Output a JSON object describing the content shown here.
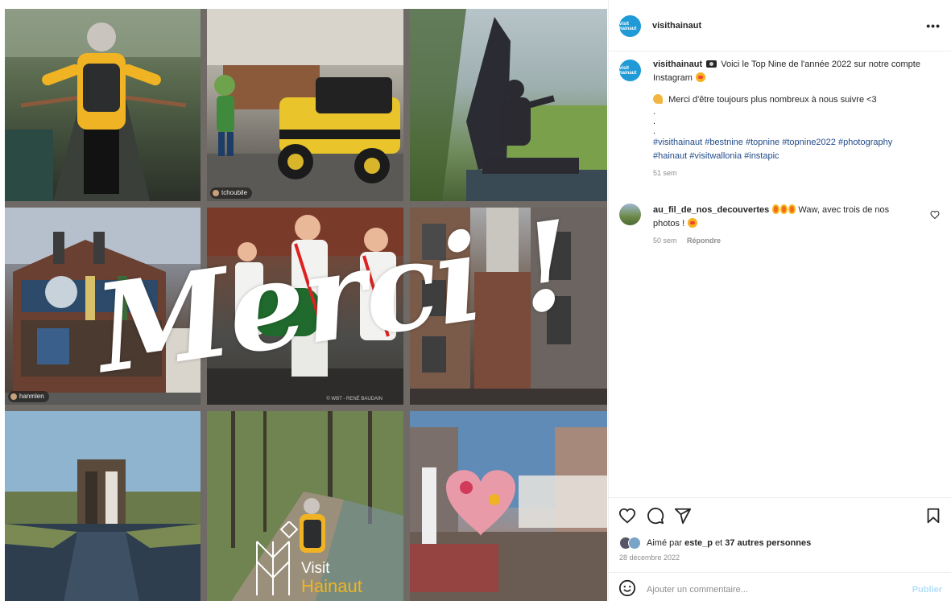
{
  "post": {
    "username": "visithainaut",
    "avatar_text": "visit hainaut",
    "more_label": "•••",
    "caption": {
      "text_1": "Voici le Top Nine de l'année 2022 sur notre compte Instagram",
      "text_2": "Merci d'être toujours plus nombreux à nous suivre <3",
      "dots": [
        ".",
        ".",
        "."
      ],
      "hashtags": "#visithainaut #bestnine #topnine #topnine2022 #photography #hainaut #visitwallonia #instapic",
      "time": "51 sem"
    },
    "comment": {
      "username": "au_fil_de_nos_decouvertes",
      "text": "Waw, avec trois de nos photos !",
      "time": "50 sem",
      "reply_label": "Répondre"
    },
    "likes": {
      "prefix": "Aimé par",
      "user": "este_p",
      "middle": "et",
      "others": "37 autres personnes"
    },
    "date": "28 décembre 2022",
    "add_comment": {
      "placeholder": "Ajouter un commentaire...",
      "publish_label": "Publier"
    }
  },
  "image": {
    "overlay_text": "Merci !",
    "tile_tags": {
      "tile2": "tchoubile",
      "tile4": "hanmlen"
    },
    "tile5_credit": "© WBT - RENÉ BAUDAIN",
    "logo_text_1": "Visit",
    "logo_text_2": "Hainaut"
  },
  "colors": {
    "brand_blue": "#1f9ad6",
    "hashtag": "#1f4a8a",
    "logo_yellow": "#f2b51c",
    "publish_disabled": "#b2dffc"
  },
  "icons": [
    "heart-icon",
    "comment-icon",
    "share-icon",
    "bookmark-icon",
    "emoji-icon",
    "more-icon"
  ]
}
